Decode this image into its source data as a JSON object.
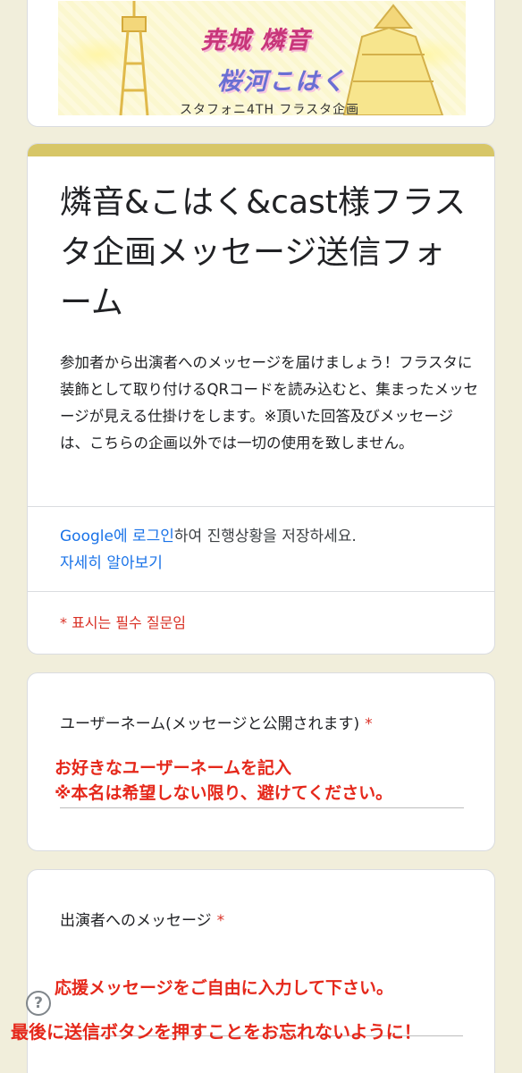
{
  "banner": {
    "title_line1": "尭城 燐音",
    "title_line2": "桜河こはく",
    "subtitle": "スタフォニ4TH フラスタ企画"
  },
  "form": {
    "title": "燐音&こはく&cast様フラスタ企画メッセージ送信フォーム",
    "description": "参加者から出演者へのメッセージを届けましょう！フラスタに装飾として取り付けるQRコードを読み込むと、集まったメッセージが見える仕掛けをします。※頂いた回答及びメッセージは、こちらの企画以外では一切の使用を致しません。",
    "login_link": "Google에 로그인",
    "login_rest": "하여 진행상황을 저장하세요.",
    "learn_more": "자세히 알아보기",
    "required_note": "* 표시는 필수 질문임"
  },
  "questions": [
    {
      "label": "ユーザーネーム(メッセージと公開されます)",
      "required_mark": "*",
      "hint_line1": "お好きなユーザーネームを記入",
      "hint_line2": "※本名は希望しない限り、避けてください。"
    },
    {
      "label": "出演者へのメッセージ",
      "required_mark": "*",
      "hint_line1": "応援メッセージをご自由に入力して下さい。"
    }
  ],
  "help": {
    "symbol": "?"
  },
  "footer_note": "最後に送信ボタンを押すことをお忘れないように！",
  "colors": {
    "background": "#f1eedb",
    "accent": "#d7c667",
    "link": "#1a73e8",
    "required": "#d93025",
    "annotation": "#e5281b"
  }
}
